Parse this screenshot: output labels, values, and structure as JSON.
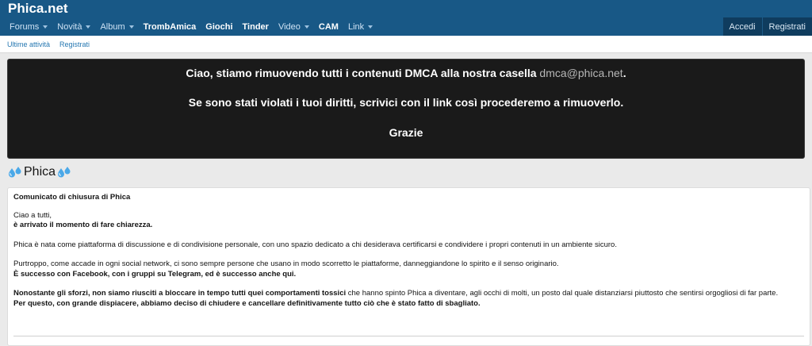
{
  "header": {
    "site_title": "Phica.net"
  },
  "nav": {
    "items": [
      {
        "label": "Forums",
        "dropdown": true,
        "bold": false
      },
      {
        "label": "Novità",
        "dropdown": true,
        "bold": false
      },
      {
        "label": "Album",
        "dropdown": true,
        "bold": false
      },
      {
        "label": "TrombAmica",
        "dropdown": false,
        "bold": true
      },
      {
        "label": "Giochi",
        "dropdown": false,
        "bold": true
      },
      {
        "label": "Tinder",
        "dropdown": false,
        "bold": true
      },
      {
        "label": "Video",
        "dropdown": true,
        "bold": false
      },
      {
        "label": "CAM",
        "dropdown": false,
        "bold": true
      },
      {
        "label": "Link",
        "dropdown": true,
        "bold": false
      }
    ],
    "login_label": "Accedi",
    "register_label": "Registrati"
  },
  "subnav": {
    "latest_activity": "Ultime attività",
    "register": "Registrati"
  },
  "notice": {
    "line1_prefix": "Ciao, stiamo rimuovendo tutti i contenuti DMCA alla nostra casella ",
    "email": "dmca@phica.net",
    "line1_suffix": ".",
    "line2": "Se sono stati violati i tuoi diritti, scrivici con il link così procederemo a rimuoverlo.",
    "line3": "Grazie"
  },
  "page": {
    "heading": "Phica",
    "heading_icon": "sweat-droplets-icon"
  },
  "announcement": {
    "title": "Comunicato di chiusura di Phica",
    "greeting": "Ciao a tutti,",
    "greeting_bold": "è arrivato il momento di fare chiarezza.",
    "para1": "Phica è nata come piattaforma di discussione e di condivisione personale, con uno spazio dedicato a chi desiderava certificarsi e condividere i propri contenuti in un ambiente sicuro.",
    "para2": "Purtroppo, come accade in ogni social network, ci sono sempre persone che usano in modo scorretto le piattaforme, danneggiandone lo spirito e il senso originario.",
    "para2_bold": "È successo con Facebook, con i gruppi su Telegram, ed è successo anche qui.",
    "para3_bold": "Nonostante gli sforzi, non siamo riusciti a bloccare in tempo tutti quei comportamenti tossici",
    "para3_rest": " che hanno spinto Phica a diventare, agli occhi di molti, un posto dal quale distanziarsi piuttosto che sentirsi orgogliosi di far parte.",
    "para4_bold": "Per questo, con grande dispiacere, abbiamo deciso di chiudere e cancellare definitivamente tutto ciò che è stato fatto di sbagliato."
  },
  "colors": {
    "header_bg": "#185886",
    "notice_bg": "#1a1a1a",
    "link": "#2577b1"
  }
}
